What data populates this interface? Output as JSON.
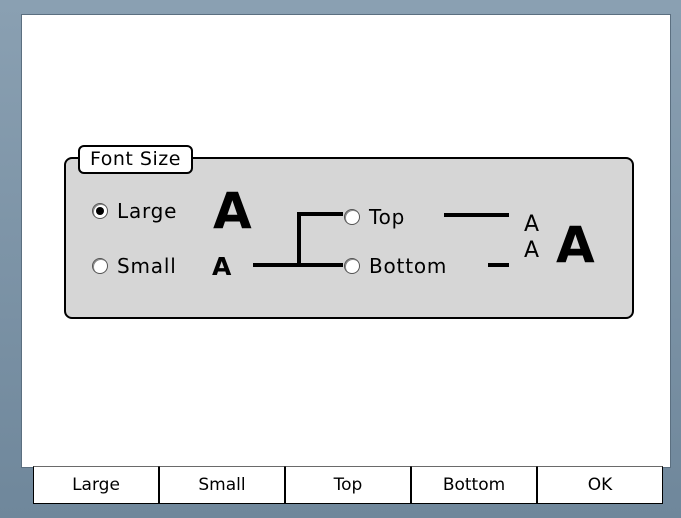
{
  "panel": {
    "title": "Font Size",
    "size_options": [
      {
        "label": "Large",
        "checked": true
      },
      {
        "label": "Small",
        "checked": false
      }
    ],
    "position_options": [
      {
        "label": "Top",
        "checked": false
      },
      {
        "label": "Bottom",
        "checked": false
      }
    ],
    "glyphs": {
      "large": "A",
      "small": "A",
      "stack_top": "A",
      "stack_bottom": "A",
      "result": "A"
    }
  },
  "softkeys": [
    "Large",
    "Small",
    "Top",
    "Bottom",
    "OK"
  ]
}
